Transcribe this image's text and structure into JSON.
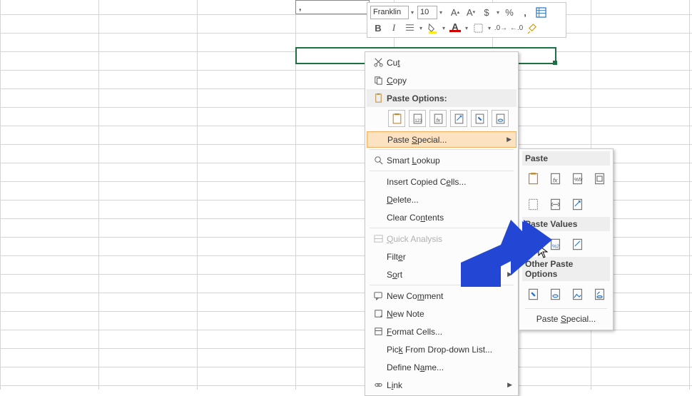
{
  "cell": {
    "text": ","
  },
  "mini": {
    "font": "Franklin",
    "size": "10",
    "bold": "B",
    "italic": "I"
  },
  "ctx": {
    "cut": "Cut",
    "copy": "Copy",
    "paste_options": "Paste Options:",
    "paste_special": "Paste Special...",
    "smart_lookup": "Smart Lookup",
    "insert_copied": "Insert Copied Cells...",
    "delete": "Delete...",
    "clear": "Clear Contents",
    "quick_analysis": "Quick Analysis",
    "filter": "Filter",
    "sort": "Sort",
    "new_comment": "New Comment",
    "new_note": "New Note",
    "format_cells": "Format Cells...",
    "pick_list": "Pick From Drop-down List...",
    "define_name": "Define Name...",
    "link": "Link"
  },
  "sub": {
    "paste": "Paste",
    "paste_values": "Paste Values",
    "other": "Other Paste Options",
    "paste_special": "Paste Special..."
  }
}
